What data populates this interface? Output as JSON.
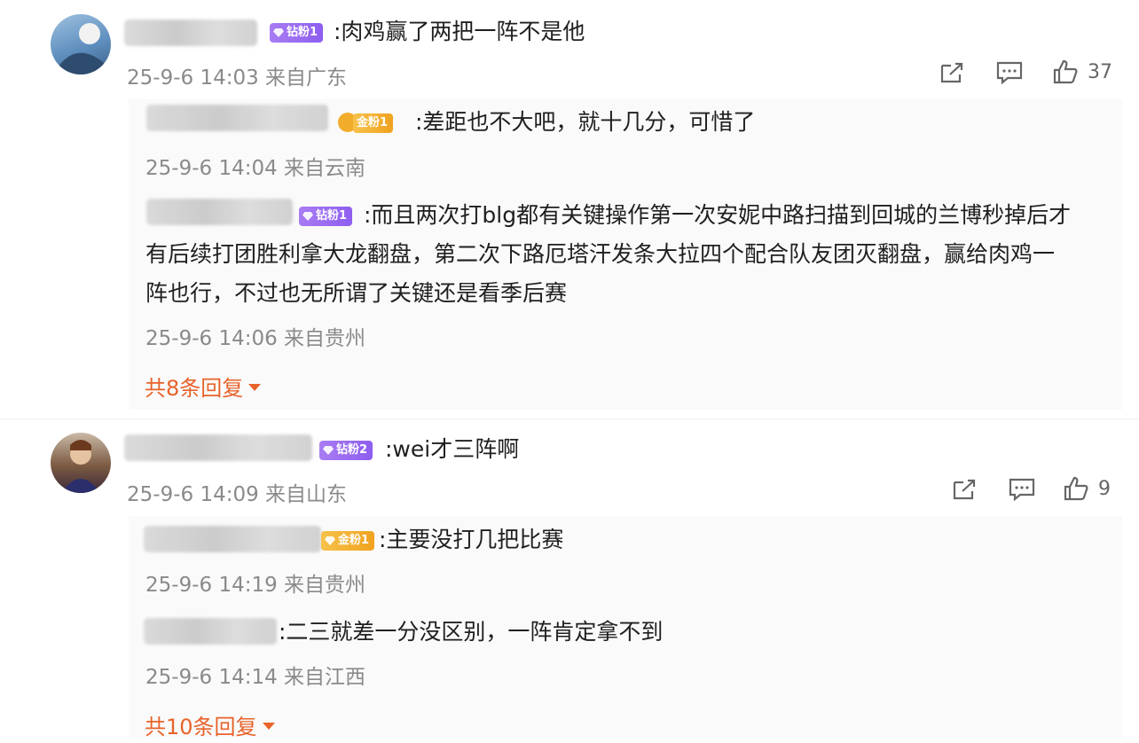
{
  "comments": [
    {
      "badge": "钻粉1",
      "badge_type": "diamond",
      "text": ":肉鸡赢了两把一阵不是他",
      "meta": "25-9-6 14:03 来自广东",
      "likes": "37",
      "replies": [
        {
          "badge": "金粉1",
          "badge_type": "gold",
          "text": ":差距也不大吧，就十几分，可惜了",
          "meta": "25-9-6 14:04 来自云南"
        },
        {
          "badge": "钻粉1",
          "badge_type": "diamond",
          "text_lines": [
            ":而且两次打blg都有关键操作第一次安妮中路扫描到回城的兰博秒掉后才",
            "有后续打团胜利拿大龙翻盘，第二次下路厄塔汗发条大拉四个配合队友团灭翻盘，赢给肉鸡一",
            "阵也行，不过也无所谓了关键还是看季后赛"
          ],
          "meta": "25-9-6 14:06 来自贵州"
        }
      ],
      "more_replies": "共8条回复"
    },
    {
      "badge": "钻粉2",
      "badge_type": "diamond",
      "text": ":wei才三阵啊",
      "meta": "25-9-6 14:09 来自山东",
      "likes": "9",
      "replies": [
        {
          "badge": "金粉1",
          "badge_type": "gold",
          "text": ":主要没打几把比赛",
          "meta": "25-9-6 14:19 来自贵州"
        },
        {
          "badge": "",
          "text": ":二三就差一分没区别，一阵肯定拿不到",
          "meta": "25-9-6 14:14 来自江西"
        }
      ],
      "more_replies": "共10条回复"
    }
  ],
  "icons": [
    "share-icon",
    "comment-icon",
    "like-icon",
    "chevron-down-icon",
    "diamond-icon"
  ],
  "colors": {
    "accent": "#e8632a",
    "diamond_badge": "#9a6cf1",
    "gold_badge": "#f2ac2b",
    "meta_text": "#8a8a8a"
  }
}
